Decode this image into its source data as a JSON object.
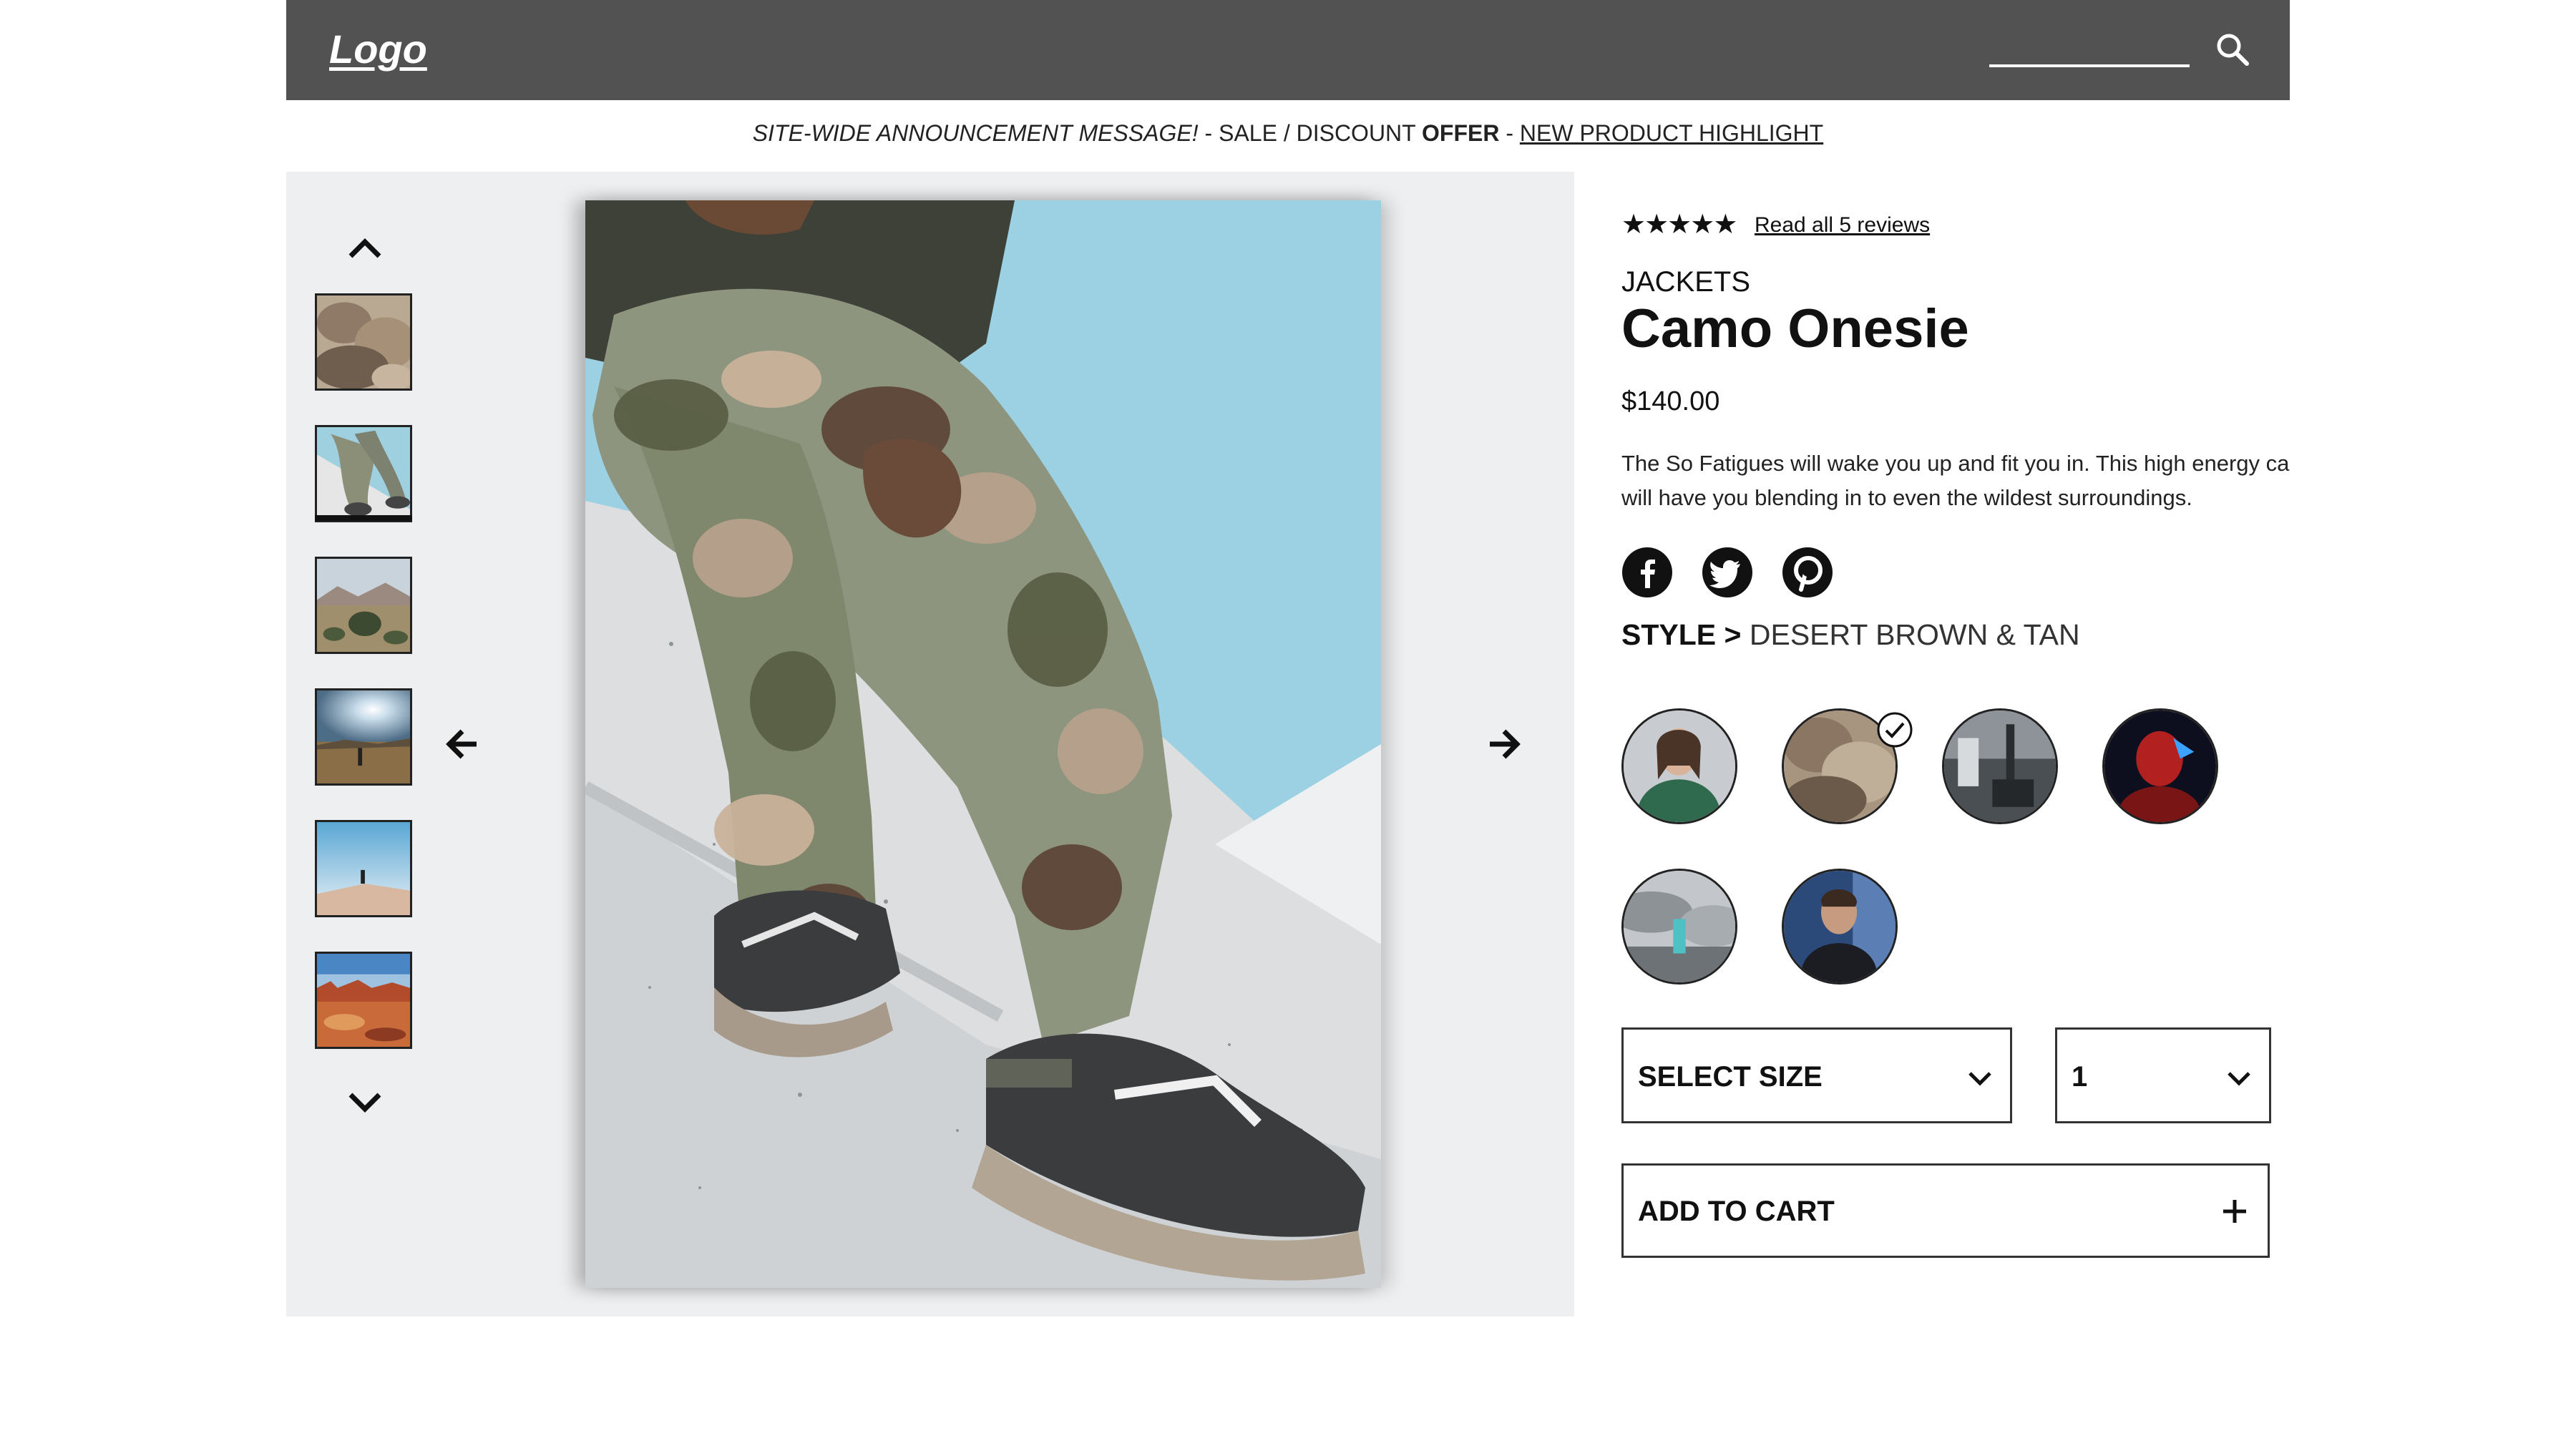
{
  "header": {
    "logo": "Logo",
    "search_placeholder": "",
    "search_icon": "search-icon"
  },
  "announcement": {
    "part1": "SITE-WIDE ANNOUNCEMENT MESSAGE!",
    "sep1": " - SALE / DISCOUNT ",
    "offer": "OFFER",
    "sep2": " - ",
    "link": "NEW PRODUCT HIGHLIGHT"
  },
  "gallery": {
    "thumbnails_count": 6,
    "active_thumbnail": 2,
    "icons": {
      "up": "chevron-up-icon",
      "down": "chevron-down-icon",
      "prev": "arrow-left-icon",
      "next": "arrow-right-icon"
    }
  },
  "product": {
    "rating": 5,
    "reviews_link": "Read all 5 reviews",
    "category": "JACKETS",
    "name": "Camo Onesie",
    "price": "$140.00",
    "description_line1": "The So Fatigues will wake you up and fit you in. This high energy camo",
    "description_line2": "will have you blending in to even the wildest surroundings.",
    "social": [
      "facebook-icon",
      "twitter-icon",
      "pinterest-icon"
    ],
    "style_label": "STYLE >",
    "style_value": "DESERT BROWN & TAN",
    "swatches_count": 6,
    "selected_swatch": 2,
    "size_select": "SELECT SIZE",
    "quantity_select": "1",
    "add_to_cart": "ADD TO CART"
  },
  "colors": {
    "header_bg": "#525252",
    "gallery_bg": "#eeeff1",
    "text": "#111111"
  }
}
